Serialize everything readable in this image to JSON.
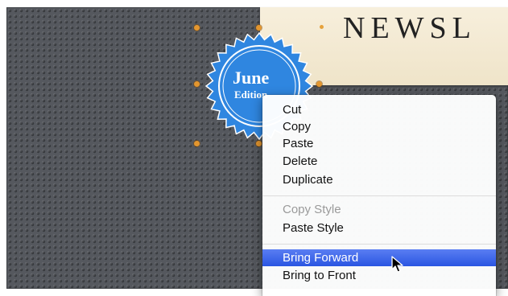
{
  "banner": {
    "title": "NEWSL"
  },
  "badge": {
    "line1": "June",
    "line2": "Edition",
    "color": "#2f86e0"
  },
  "context_menu": {
    "group1": [
      "Cut",
      "Copy",
      "Paste",
      "Delete",
      "Duplicate"
    ],
    "group2": [
      "Copy Style",
      "Paste Style"
    ],
    "group3": [
      "Bring Forward",
      "Bring to Front"
    ],
    "highlighted": "Bring Forward",
    "disabled": "Copy Style",
    "highlight_color": "#3d66ea"
  },
  "icons": {
    "selection_handle": "selection-handle",
    "pointer": "arrow-cursor-icon"
  }
}
